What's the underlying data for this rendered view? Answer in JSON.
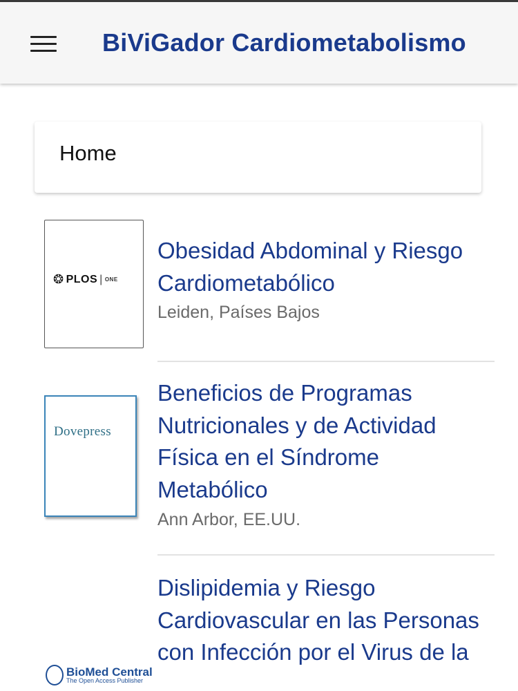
{
  "app_bar": {
    "title": "BiViGador Cardiometabolismo",
    "menu_icon": "hamburger-menu-icon",
    "title_color": "#1a3a8c"
  },
  "breadcrumb": {
    "label": "Home"
  },
  "articles": [
    {
      "title": "Obesidad Abdominal y Riesgo Cardiometabólico",
      "location": "Leiden, Países Bajos",
      "publisher_logo": {
        "name": "PLOS",
        "suffix": "ONE"
      }
    },
    {
      "title": "Beneficios de Programas Nutricionales y de Actividad Física en el Síndrome Metabólico",
      "location": "Ann Arbor, EE.UU.",
      "publisher_logo": {
        "name": "Dovepress"
      }
    },
    {
      "title": "Dislipidemia y Riesgo Cardiovascular en las Personas con Infección por el Virus de la",
      "location": "",
      "publisher_logo": {
        "name": "BioMed Central",
        "tagline": "The Open Access Publisher"
      }
    }
  ]
}
